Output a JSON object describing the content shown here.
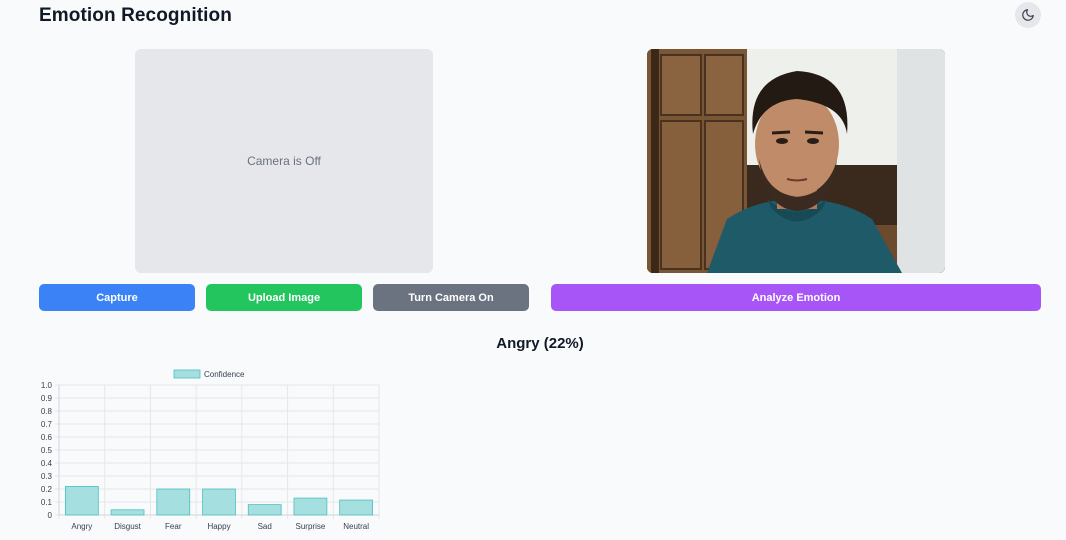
{
  "app": {
    "title": "Emotion Recognition",
    "theme_toggle_icon": "moon-icon"
  },
  "camera": {
    "status_text": "Camera is Off"
  },
  "captured_image": {
    "icon": "person-photo"
  },
  "buttons": {
    "capture": "Capture",
    "upload": "Upload Image",
    "camera_toggle": "Turn Camera On",
    "analyze": "Analyze Emotion"
  },
  "colors": {
    "capture": "#3b82f6",
    "upload": "#22c55e",
    "camera_toggle": "#6b7280",
    "analyze": "#a855f7",
    "bar_fill": "#a5dfe0",
    "bar_stroke": "#4bc0c0"
  },
  "result": {
    "text": "Angry (22%)"
  },
  "chart_data": {
    "type": "bar",
    "categories": [
      "Angry",
      "Disgust",
      "Fear",
      "Happy",
      "Sad",
      "Surprise",
      "Neutral"
    ],
    "series": [
      {
        "name": "Confidence",
        "values": [
          0.22,
          0.04,
          0.2,
          0.2,
          0.08,
          0.13,
          0.115
        ]
      }
    ],
    "ylim": [
      0,
      1
    ],
    "yticks": [
      "1.0",
      "0.9",
      "0.8",
      "0.7",
      "0.6",
      "0.5",
      "0.4",
      "0.3",
      "0.2",
      "0.1",
      "0"
    ],
    "grid": true,
    "legend": "top"
  }
}
